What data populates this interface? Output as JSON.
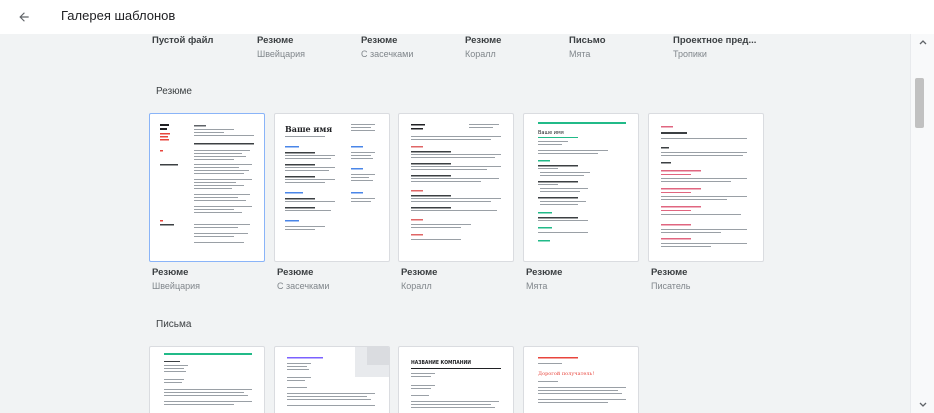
{
  "header": {
    "title": "Галерея шаблонов",
    "back_icon": "arrow-back-icon"
  },
  "top_row": [
    {
      "name": "Пустой файл",
      "sub": ""
    },
    {
      "name": "Резюме",
      "sub": "Швейцария"
    },
    {
      "name": "Резюме",
      "sub": "С засечками"
    },
    {
      "name": "Резюме",
      "sub": "Коралл"
    },
    {
      "name": "Письмо",
      "sub": "Мята"
    },
    {
      "name": "Проектное пред...",
      "sub": "Тропики"
    }
  ],
  "sections": {
    "resume": {
      "title": "Резюме",
      "templates": [
        {
          "name": "Резюме",
          "sub": "Швейцария",
          "accent": "#e8453c"
        },
        {
          "name": "Резюме",
          "sub": "С засечками",
          "accent": "#4a86e8"
        },
        {
          "name": "Резюме",
          "sub": "Коралл",
          "accent": "#e06666"
        },
        {
          "name": "Резюме",
          "sub": "Мята",
          "accent": "#21ba88"
        },
        {
          "name": "Резюме",
          "sub": "Писатель",
          "accent": "#e06680"
        }
      ]
    },
    "letters": {
      "title": "Письма",
      "previews": [
        {
          "accent": "#21ba88"
        },
        {
          "accent": "#7b61ff"
        },
        {
          "accent": "#202124"
        },
        {
          "accent": "#e8453c"
        }
      ]
    }
  },
  "preview_text": {
    "your_name": "Ваше имя",
    "company_name": "НАЗВАНИЕ КОМПАНИИ",
    "dear": "Дорогой получатель!"
  },
  "colors": {
    "selected_border": "#8ab4f8",
    "background": "#f1f3f4"
  }
}
